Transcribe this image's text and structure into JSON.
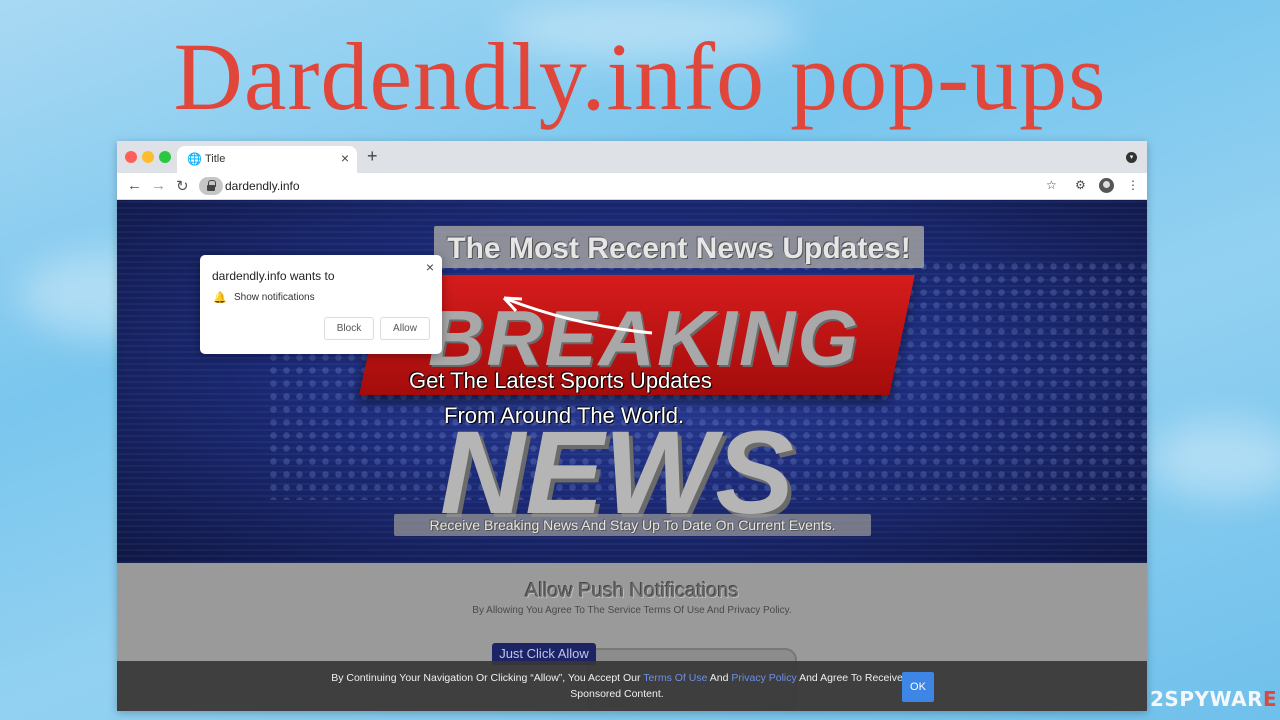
{
  "headline": "Dardendly.info pop-ups",
  "browser": {
    "tab_title": "Title",
    "new_tab": "+",
    "url": "dardendly.info"
  },
  "permission": {
    "title": "dardendly.info wants to",
    "request": "Show notifications",
    "block": "Block",
    "allow": "Allow"
  },
  "hero": {
    "banner": "The Most Recent News Updates!",
    "breaking": "BREAKING",
    "line1": "Get The Latest Sports Updates",
    "line2": "From Around The World.",
    "news": "NEWS",
    "strip": "Receive Breaking News And Stay Up To Date On Current Events."
  },
  "lower": {
    "title": "Allow Push Notifications",
    "subtitle": "By Allowing You Agree To The Service Terms Of Use And Privacy Policy.",
    "button": "Just Click Allow"
  },
  "cookie": {
    "part1": "By Continuing Your Navigation Or Clicking “Allow”, You Accept Our ",
    "terms": "Terms Of Use",
    "and": " And ",
    "privacy": "Privacy Policy",
    "part2": " And Agree To Receive Sponsored Content.",
    "ok": "OK"
  },
  "watermark": {
    "digit": "2",
    "brand_white": "SPYWAR",
    "brand_red": "E"
  },
  "colors": {
    "headline": "#e0463a",
    "ok_button": "#3d86e6",
    "link": "#6f8fe8",
    "red_band": "#d61c1c",
    "page_bg": "#0d1436"
  },
  "icons": [
    "globe-icon",
    "close-icon",
    "back-icon",
    "forward-icon",
    "reload-icon",
    "lock-icon",
    "star-icon",
    "extensions-icon",
    "profile-icon",
    "menu-icon",
    "bell-icon",
    "arrow-icon"
  ]
}
